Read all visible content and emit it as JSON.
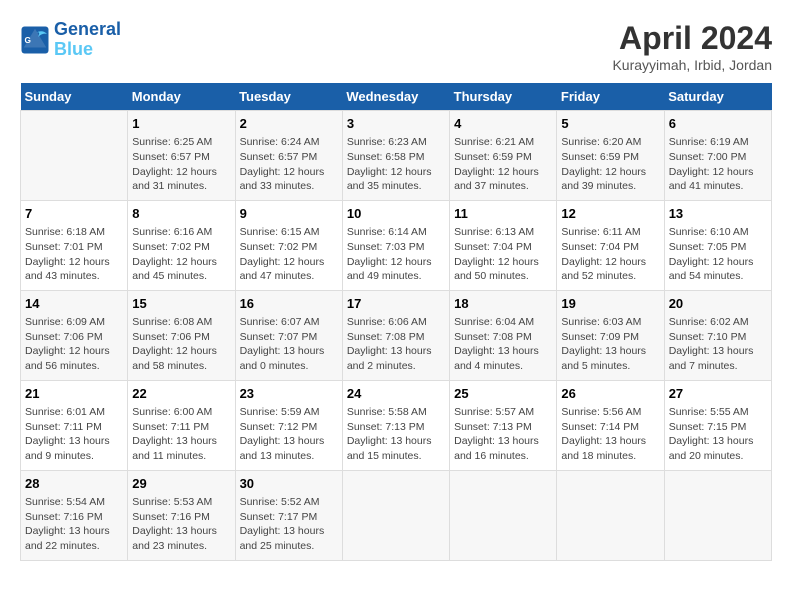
{
  "header": {
    "logo_line1": "General",
    "logo_line2": "Blue",
    "title": "April 2024",
    "location": "Kurayyimah, Irbid, Jordan"
  },
  "days_of_week": [
    "Sunday",
    "Monday",
    "Tuesday",
    "Wednesday",
    "Thursday",
    "Friday",
    "Saturday"
  ],
  "weeks": [
    [
      {
        "day": "",
        "info": ""
      },
      {
        "day": "1",
        "info": "Sunrise: 6:25 AM\nSunset: 6:57 PM\nDaylight: 12 hours\nand 31 minutes."
      },
      {
        "day": "2",
        "info": "Sunrise: 6:24 AM\nSunset: 6:57 PM\nDaylight: 12 hours\nand 33 minutes."
      },
      {
        "day": "3",
        "info": "Sunrise: 6:23 AM\nSunset: 6:58 PM\nDaylight: 12 hours\nand 35 minutes."
      },
      {
        "day": "4",
        "info": "Sunrise: 6:21 AM\nSunset: 6:59 PM\nDaylight: 12 hours\nand 37 minutes."
      },
      {
        "day": "5",
        "info": "Sunrise: 6:20 AM\nSunset: 6:59 PM\nDaylight: 12 hours\nand 39 minutes."
      },
      {
        "day": "6",
        "info": "Sunrise: 6:19 AM\nSunset: 7:00 PM\nDaylight: 12 hours\nand 41 minutes."
      }
    ],
    [
      {
        "day": "7",
        "info": "Sunrise: 6:18 AM\nSunset: 7:01 PM\nDaylight: 12 hours\nand 43 minutes."
      },
      {
        "day": "8",
        "info": "Sunrise: 6:16 AM\nSunset: 7:02 PM\nDaylight: 12 hours\nand 45 minutes."
      },
      {
        "day": "9",
        "info": "Sunrise: 6:15 AM\nSunset: 7:02 PM\nDaylight: 12 hours\nand 47 minutes."
      },
      {
        "day": "10",
        "info": "Sunrise: 6:14 AM\nSunset: 7:03 PM\nDaylight: 12 hours\nand 49 minutes."
      },
      {
        "day": "11",
        "info": "Sunrise: 6:13 AM\nSunset: 7:04 PM\nDaylight: 12 hours\nand 50 minutes."
      },
      {
        "day": "12",
        "info": "Sunrise: 6:11 AM\nSunset: 7:04 PM\nDaylight: 12 hours\nand 52 minutes."
      },
      {
        "day": "13",
        "info": "Sunrise: 6:10 AM\nSunset: 7:05 PM\nDaylight: 12 hours\nand 54 minutes."
      }
    ],
    [
      {
        "day": "14",
        "info": "Sunrise: 6:09 AM\nSunset: 7:06 PM\nDaylight: 12 hours\nand 56 minutes."
      },
      {
        "day": "15",
        "info": "Sunrise: 6:08 AM\nSunset: 7:06 PM\nDaylight: 12 hours\nand 58 minutes."
      },
      {
        "day": "16",
        "info": "Sunrise: 6:07 AM\nSunset: 7:07 PM\nDaylight: 13 hours\nand 0 minutes."
      },
      {
        "day": "17",
        "info": "Sunrise: 6:06 AM\nSunset: 7:08 PM\nDaylight: 13 hours\nand 2 minutes."
      },
      {
        "day": "18",
        "info": "Sunrise: 6:04 AM\nSunset: 7:08 PM\nDaylight: 13 hours\nand 4 minutes."
      },
      {
        "day": "19",
        "info": "Sunrise: 6:03 AM\nSunset: 7:09 PM\nDaylight: 13 hours\nand 5 minutes."
      },
      {
        "day": "20",
        "info": "Sunrise: 6:02 AM\nSunset: 7:10 PM\nDaylight: 13 hours\nand 7 minutes."
      }
    ],
    [
      {
        "day": "21",
        "info": "Sunrise: 6:01 AM\nSunset: 7:11 PM\nDaylight: 13 hours\nand 9 minutes."
      },
      {
        "day": "22",
        "info": "Sunrise: 6:00 AM\nSunset: 7:11 PM\nDaylight: 13 hours\nand 11 minutes."
      },
      {
        "day": "23",
        "info": "Sunrise: 5:59 AM\nSunset: 7:12 PM\nDaylight: 13 hours\nand 13 minutes."
      },
      {
        "day": "24",
        "info": "Sunrise: 5:58 AM\nSunset: 7:13 PM\nDaylight: 13 hours\nand 15 minutes."
      },
      {
        "day": "25",
        "info": "Sunrise: 5:57 AM\nSunset: 7:13 PM\nDaylight: 13 hours\nand 16 minutes."
      },
      {
        "day": "26",
        "info": "Sunrise: 5:56 AM\nSunset: 7:14 PM\nDaylight: 13 hours\nand 18 minutes."
      },
      {
        "day": "27",
        "info": "Sunrise: 5:55 AM\nSunset: 7:15 PM\nDaylight: 13 hours\nand 20 minutes."
      }
    ],
    [
      {
        "day": "28",
        "info": "Sunrise: 5:54 AM\nSunset: 7:16 PM\nDaylight: 13 hours\nand 22 minutes."
      },
      {
        "day": "29",
        "info": "Sunrise: 5:53 AM\nSunset: 7:16 PM\nDaylight: 13 hours\nand 23 minutes."
      },
      {
        "day": "30",
        "info": "Sunrise: 5:52 AM\nSunset: 7:17 PM\nDaylight: 13 hours\nand 25 minutes."
      },
      {
        "day": "",
        "info": ""
      },
      {
        "day": "",
        "info": ""
      },
      {
        "day": "",
        "info": ""
      },
      {
        "day": "",
        "info": ""
      }
    ]
  ]
}
